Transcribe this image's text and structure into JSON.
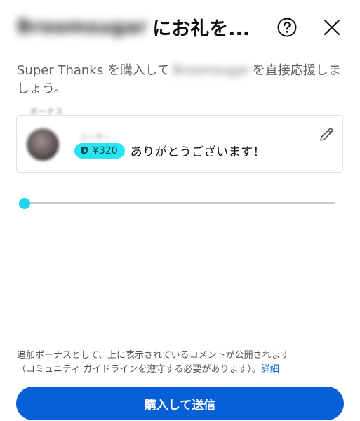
{
  "header": {
    "channel_name_blurred": "Broomsugar",
    "title_suffix": "にお礼を...",
    "help_icon": "help-circle-icon",
    "close_icon": "close-icon"
  },
  "description": {
    "prefix": "Super Thanks を購入して",
    "channel_name_blurred": "Broomsugar",
    "suffix": "を直接応援しましょう。"
  },
  "bonus": {
    "label": "ボーナス"
  },
  "comment_card": {
    "commenter_blurred": "ユーザー",
    "amount": "¥320",
    "amount_icon": "shield-icon",
    "text": "ありがとうございます！",
    "edit_icon": "pencil-icon"
  },
  "slider": {
    "value_fraction": 0.0
  },
  "disclaimer": {
    "line1": "追加ボーナスとして、上に表示されているコメントが公開されます",
    "line2": "（コミュニティ ガイドラインを遵守する必要があります）。",
    "link": "詳細"
  },
  "buy_button": {
    "label": "購入して送信"
  },
  "colors": {
    "accent_cyan": "#2ae3f1",
    "primary_blue": "#065fd4"
  }
}
